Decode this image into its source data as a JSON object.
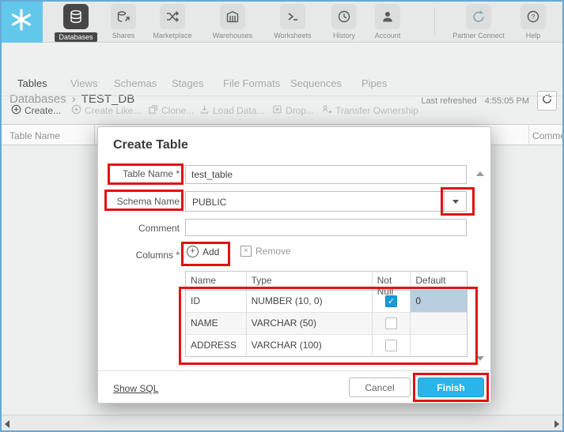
{
  "app": {
    "name": "Snowflake"
  },
  "nav": {
    "items": [
      {
        "label": "Databases",
        "selected": true
      },
      {
        "label": "Shares"
      },
      {
        "label": "Marketplace"
      },
      {
        "label": "Warehouses"
      },
      {
        "label": "Worksheets"
      },
      {
        "label": "History"
      },
      {
        "label": "Account"
      },
      {
        "label": "Partner Connect"
      },
      {
        "label": "Help"
      }
    ]
  },
  "breadcrumb": {
    "root": "Databases",
    "separator": "›",
    "current": "TEST_DB",
    "last_refreshed_label": "Last refreshed",
    "last_refreshed_time": "4:55:05 PM"
  },
  "tabs": [
    "Tables",
    "Views",
    "Schemas",
    "Stages",
    "File Formats",
    "Sequences",
    "Pipes"
  ],
  "toolbar": [
    {
      "label": "Create...",
      "enabled": true
    },
    {
      "label": "Create Like...",
      "enabled": false
    },
    {
      "label": "Clone...",
      "enabled": false
    },
    {
      "label": "Load Data...",
      "enabled": false
    },
    {
      "label": "Drop...",
      "enabled": false
    },
    {
      "label": "Transfer Ownership",
      "enabled": false
    }
  ],
  "list": {
    "columns": [
      "Table Name",
      "Comment"
    ]
  },
  "modal": {
    "title": "Create Table",
    "table_name": {
      "label": "Table Name *",
      "value": "test_table"
    },
    "schema": {
      "label": "Schema Name",
      "value": "PUBLIC"
    },
    "comment": {
      "label": "Comment",
      "value": ""
    },
    "columns": {
      "label": "Columns *",
      "add": "Add",
      "remove": "Remove"
    },
    "grid": {
      "headers": [
        "Name",
        "Type",
        "Not Null",
        "Default"
      ],
      "rows": [
        {
          "name": "ID",
          "type": "NUMBER (10, 0)",
          "not_null": true,
          "default": "0"
        },
        {
          "name": "NAME",
          "type": "VARCHAR (50)",
          "not_null": false,
          "default": ""
        },
        {
          "name": "ADDRESS",
          "type": "VARCHAR (100)",
          "not_null": false,
          "default": ""
        }
      ]
    },
    "footer": {
      "show_sql": "Show SQL",
      "cancel": "Cancel",
      "finish": "Finish"
    }
  },
  "colors": {
    "accent": "#29b5e8",
    "annotation": "#e01212",
    "logo_bg": "#62c9ea",
    "selected_nav": "#474747"
  }
}
